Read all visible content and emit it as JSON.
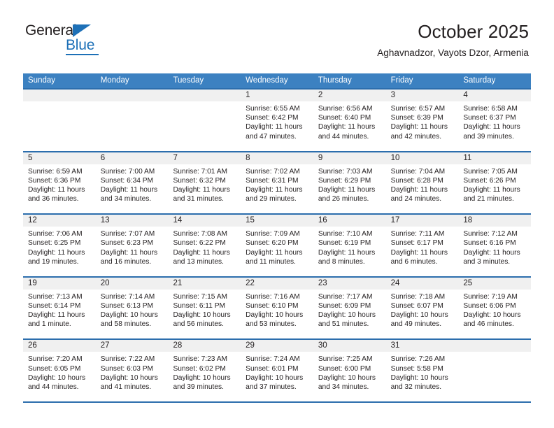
{
  "logo": {
    "word_dark": "General",
    "word_blue": "Blue",
    "triangle_color": "#1d70b7"
  },
  "header": {
    "title": "October 2025",
    "subtitle": "Aghavnadzor, Vayots Dzor, Armenia"
  },
  "theme": {
    "header_blue": "#3c81c1",
    "rule_blue": "#2c6ead",
    "day_band": "#f0f0f0",
    "text": "#231f20"
  },
  "weekdays": [
    "Sunday",
    "Monday",
    "Tuesday",
    "Wednesday",
    "Thursday",
    "Friday",
    "Saturday"
  ],
  "weeks": [
    [
      {
        "day": "",
        "lines": [
          "",
          "",
          "",
          ""
        ]
      },
      {
        "day": "",
        "lines": [
          "",
          "",
          "",
          ""
        ]
      },
      {
        "day": "",
        "lines": [
          "",
          "",
          "",
          ""
        ]
      },
      {
        "day": "1",
        "lines": [
          "Sunrise: 6:55 AM",
          "Sunset: 6:42 PM",
          "Daylight: 11 hours",
          "and 47 minutes."
        ]
      },
      {
        "day": "2",
        "lines": [
          "Sunrise: 6:56 AM",
          "Sunset: 6:40 PM",
          "Daylight: 11 hours",
          "and 44 minutes."
        ]
      },
      {
        "day": "3",
        "lines": [
          "Sunrise: 6:57 AM",
          "Sunset: 6:39 PM",
          "Daylight: 11 hours",
          "and 42 minutes."
        ]
      },
      {
        "day": "4",
        "lines": [
          "Sunrise: 6:58 AM",
          "Sunset: 6:37 PM",
          "Daylight: 11 hours",
          "and 39 minutes."
        ]
      }
    ],
    [
      {
        "day": "5",
        "lines": [
          "Sunrise: 6:59 AM",
          "Sunset: 6:36 PM",
          "Daylight: 11 hours",
          "and 36 minutes."
        ]
      },
      {
        "day": "6",
        "lines": [
          "Sunrise: 7:00 AM",
          "Sunset: 6:34 PM",
          "Daylight: 11 hours",
          "and 34 minutes."
        ]
      },
      {
        "day": "7",
        "lines": [
          "Sunrise: 7:01 AM",
          "Sunset: 6:32 PM",
          "Daylight: 11 hours",
          "and 31 minutes."
        ]
      },
      {
        "day": "8",
        "lines": [
          "Sunrise: 7:02 AM",
          "Sunset: 6:31 PM",
          "Daylight: 11 hours",
          "and 29 minutes."
        ]
      },
      {
        "day": "9",
        "lines": [
          "Sunrise: 7:03 AM",
          "Sunset: 6:29 PM",
          "Daylight: 11 hours",
          "and 26 minutes."
        ]
      },
      {
        "day": "10",
        "lines": [
          "Sunrise: 7:04 AM",
          "Sunset: 6:28 PM",
          "Daylight: 11 hours",
          "and 24 minutes."
        ]
      },
      {
        "day": "11",
        "lines": [
          "Sunrise: 7:05 AM",
          "Sunset: 6:26 PM",
          "Daylight: 11 hours",
          "and 21 minutes."
        ]
      }
    ],
    [
      {
        "day": "12",
        "lines": [
          "Sunrise: 7:06 AM",
          "Sunset: 6:25 PM",
          "Daylight: 11 hours",
          "and 19 minutes."
        ]
      },
      {
        "day": "13",
        "lines": [
          "Sunrise: 7:07 AM",
          "Sunset: 6:23 PM",
          "Daylight: 11 hours",
          "and 16 minutes."
        ]
      },
      {
        "day": "14",
        "lines": [
          "Sunrise: 7:08 AM",
          "Sunset: 6:22 PM",
          "Daylight: 11 hours",
          "and 13 minutes."
        ]
      },
      {
        "day": "15",
        "lines": [
          "Sunrise: 7:09 AM",
          "Sunset: 6:20 PM",
          "Daylight: 11 hours",
          "and 11 minutes."
        ]
      },
      {
        "day": "16",
        "lines": [
          "Sunrise: 7:10 AM",
          "Sunset: 6:19 PM",
          "Daylight: 11 hours",
          "and 8 minutes."
        ]
      },
      {
        "day": "17",
        "lines": [
          "Sunrise: 7:11 AM",
          "Sunset: 6:17 PM",
          "Daylight: 11 hours",
          "and 6 minutes."
        ]
      },
      {
        "day": "18",
        "lines": [
          "Sunrise: 7:12 AM",
          "Sunset: 6:16 PM",
          "Daylight: 11 hours",
          "and 3 minutes."
        ]
      }
    ],
    [
      {
        "day": "19",
        "lines": [
          "Sunrise: 7:13 AM",
          "Sunset: 6:14 PM",
          "Daylight: 11 hours",
          "and 1 minute."
        ]
      },
      {
        "day": "20",
        "lines": [
          "Sunrise: 7:14 AM",
          "Sunset: 6:13 PM",
          "Daylight: 10 hours",
          "and 58 minutes."
        ]
      },
      {
        "day": "21",
        "lines": [
          "Sunrise: 7:15 AM",
          "Sunset: 6:11 PM",
          "Daylight: 10 hours",
          "and 56 minutes."
        ]
      },
      {
        "day": "22",
        "lines": [
          "Sunrise: 7:16 AM",
          "Sunset: 6:10 PM",
          "Daylight: 10 hours",
          "and 53 minutes."
        ]
      },
      {
        "day": "23",
        "lines": [
          "Sunrise: 7:17 AM",
          "Sunset: 6:09 PM",
          "Daylight: 10 hours",
          "and 51 minutes."
        ]
      },
      {
        "day": "24",
        "lines": [
          "Sunrise: 7:18 AM",
          "Sunset: 6:07 PM",
          "Daylight: 10 hours",
          "and 49 minutes."
        ]
      },
      {
        "day": "25",
        "lines": [
          "Sunrise: 7:19 AM",
          "Sunset: 6:06 PM",
          "Daylight: 10 hours",
          "and 46 minutes."
        ]
      }
    ],
    [
      {
        "day": "26",
        "lines": [
          "Sunrise: 7:20 AM",
          "Sunset: 6:05 PM",
          "Daylight: 10 hours",
          "and 44 minutes."
        ]
      },
      {
        "day": "27",
        "lines": [
          "Sunrise: 7:22 AM",
          "Sunset: 6:03 PM",
          "Daylight: 10 hours",
          "and 41 minutes."
        ]
      },
      {
        "day": "28",
        "lines": [
          "Sunrise: 7:23 AM",
          "Sunset: 6:02 PM",
          "Daylight: 10 hours",
          "and 39 minutes."
        ]
      },
      {
        "day": "29",
        "lines": [
          "Sunrise: 7:24 AM",
          "Sunset: 6:01 PM",
          "Daylight: 10 hours",
          "and 37 minutes."
        ]
      },
      {
        "day": "30",
        "lines": [
          "Sunrise: 7:25 AM",
          "Sunset: 6:00 PM",
          "Daylight: 10 hours",
          "and 34 minutes."
        ]
      },
      {
        "day": "31",
        "lines": [
          "Sunrise: 7:26 AM",
          "Sunset: 5:58 PM",
          "Daylight: 10 hours",
          "and 32 minutes."
        ]
      },
      {
        "day": "",
        "lines": [
          "",
          "",
          "",
          ""
        ]
      }
    ]
  ]
}
